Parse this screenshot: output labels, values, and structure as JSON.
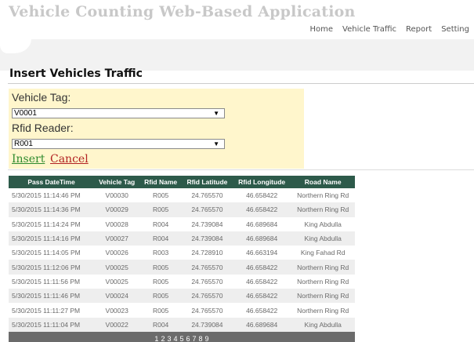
{
  "app": {
    "title": "Vehicle Counting Web-Based Application"
  },
  "nav": [
    {
      "label": "Home"
    },
    {
      "label": "Vehicle Traffic"
    },
    {
      "label": "Report"
    },
    {
      "label": "Setting"
    }
  ],
  "page": {
    "title": "Insert Vehicles Traffic"
  },
  "form": {
    "vehicle_tag_label": "Vehicle Tag:",
    "vehicle_tag_value": "V0001",
    "rfid_reader_label": "Rfid Reader:",
    "rfid_reader_value": "R001",
    "insert_label": "Insert",
    "cancel_label": "Cancel"
  },
  "table": {
    "headers": [
      "Pass DateTime",
      "Vehicle Tag",
      "Rfid Name",
      "Rfid Latitude",
      "Rfid Longitude",
      "Road Name"
    ],
    "rows": [
      [
        "5/30/2015 11:14:46 PM",
        "V00030",
        "R005",
        "24.765570",
        "46.658422",
        "Northern Ring Rd"
      ],
      [
        "5/30/2015 11:14:36 PM",
        "V00029",
        "R005",
        "24.765570",
        "46.658422",
        "Northern Ring Rd"
      ],
      [
        "5/30/2015 11:14:24 PM",
        "V00028",
        "R004",
        "24.739084",
        "46.689684",
        "King Abdulla"
      ],
      [
        "5/30/2015 11:14:16 PM",
        "V00027",
        "R004",
        "24.739084",
        "46.689684",
        "King Abdulla"
      ],
      [
        "5/30/2015 11:14:05 PM",
        "V00026",
        "R003",
        "24.728910",
        "46.663194",
        "King Fahad Rd"
      ],
      [
        "5/30/2015 11:12:06 PM",
        "V00025",
        "R005",
        "24.765570",
        "46.658422",
        "Northern Ring Rd"
      ],
      [
        "5/30/2015 11:11:56 PM",
        "V00025",
        "R005",
        "24.765570",
        "46.658422",
        "Northern Ring Rd"
      ],
      [
        "5/30/2015 11:11:46 PM",
        "V00024",
        "R005",
        "24.765570",
        "46.658422",
        "Northern Ring Rd"
      ],
      [
        "5/30/2015 11:11:27 PM",
        "V00023",
        "R005",
        "24.765570",
        "46.658422",
        "Northern Ring Rd"
      ],
      [
        "5/30/2015 11:11:04 PM",
        "V00022",
        "R004",
        "24.739084",
        "46.689684",
        "King Abdulla"
      ]
    ],
    "pager": [
      "1",
      "2",
      "3",
      "4",
      "5",
      "6",
      "7",
      "8",
      "9"
    ],
    "current_page": "1"
  },
  "colors": {
    "title_gray": "#c8c8c8",
    "form_background": "#fff6cc",
    "grid_header": "#2d5a4a",
    "pager_background": "#6b6b6b",
    "insert_link": "#2e8b2e",
    "cancel_link": "#b22222"
  }
}
